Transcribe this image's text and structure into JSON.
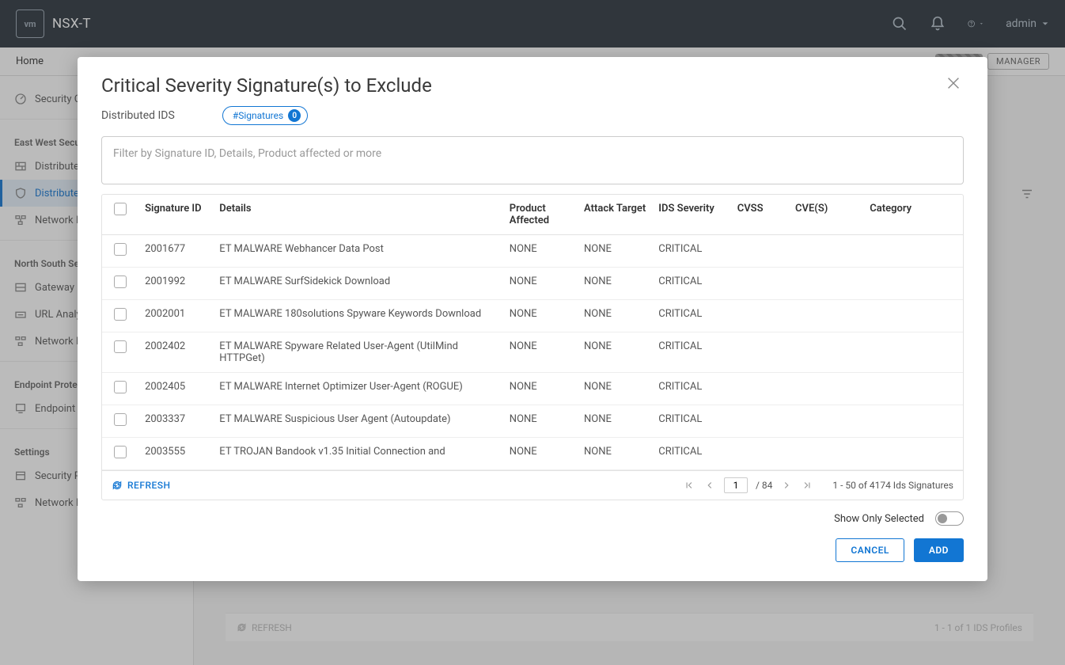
{
  "header": {
    "brand_text": "NSX-T",
    "logo_text": "vm",
    "user": "admin"
  },
  "subnav": {
    "home": "Home",
    "manager_btn": "MANAGER"
  },
  "sidebar": {
    "item_overview": "Security Overview",
    "group_ew": "East West Security",
    "item_dfw": "Distributed Firewall",
    "item_dids": "Distributed IDS",
    "item_ni1": "Network Introspection",
    "group_ns": "North South Security",
    "item_gwfw": "Gateway Firewall",
    "item_url": "URL Analysis",
    "item_ni2": "Network Introspection",
    "group_ep": "Endpoint Protection",
    "item_epr": "Endpoint Protection Rules",
    "group_set": "Settings",
    "item_prof": "Security Profiles",
    "item_ni3": "Network Introspection"
  },
  "content_stub": {
    "refresh": "REFRESH",
    "summary": "1 - 1 of 1 IDS Profiles"
  },
  "modal": {
    "title": "Critical Severity Signature(s) to Exclude",
    "subtitle": "Distributed IDS",
    "chip_label": "#Signatures",
    "chip_count": "0",
    "search_placeholder": "Filter by Signature ID, Details, Product affected or more",
    "columns": {
      "sig": "Signature ID",
      "details": "Details",
      "product": "Product Affected",
      "attack": "Attack Target",
      "severity": "IDS Severity",
      "cvss": "CVSS",
      "cve": "CVE(S)",
      "category": "Category"
    },
    "rows": [
      {
        "id": "2001677",
        "details": "ET MALWARE Webhancer Data Post",
        "product": "NONE",
        "attack": "NONE",
        "severity": "CRITICAL"
      },
      {
        "id": "2001992",
        "details": "ET MALWARE SurfSidekick Download",
        "product": "NONE",
        "attack": "NONE",
        "severity": "CRITICAL"
      },
      {
        "id": "2002001",
        "details": "ET MALWARE 180solutions Spyware Keywords Download",
        "product": "NONE",
        "attack": "NONE",
        "severity": "CRITICAL"
      },
      {
        "id": "2002402",
        "details": "ET MALWARE Spyware Related User-Agent (UtilMind HTTPGet)",
        "product": "NONE",
        "attack": "NONE",
        "severity": "CRITICAL"
      },
      {
        "id": "2002405",
        "details": "ET MALWARE Internet Optimizer User-Agent (ROGUE)",
        "product": "NONE",
        "attack": "NONE",
        "severity": "CRITICAL"
      },
      {
        "id": "2003337",
        "details": "ET MALWARE Suspicious User Agent (Autoupdate)",
        "product": "NONE",
        "attack": "NONE",
        "severity": "CRITICAL"
      },
      {
        "id": "2003555",
        "details": "ET TROJAN Bandook v1.35 Initial Connection and",
        "product": "NONE",
        "attack": "NONE",
        "severity": "CRITICAL"
      }
    ],
    "footer": {
      "refresh": "REFRESH",
      "page": "1",
      "total_pages": "/ 84",
      "summary": "1 - 50 of 4174 Ids Signatures"
    },
    "show_only_selected": "Show Only Selected",
    "cancel": "CANCEL",
    "add": "ADD"
  }
}
